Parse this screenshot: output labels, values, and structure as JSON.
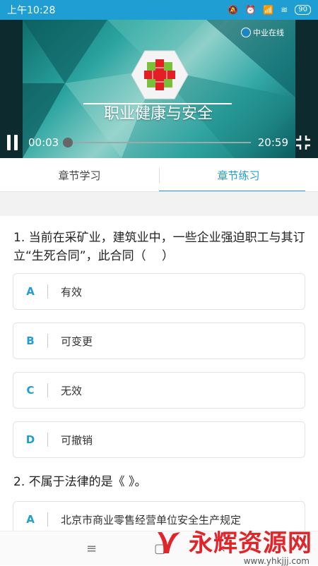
{
  "status_bar": {
    "time": "上午10:28",
    "battery": "90",
    "network": "4G"
  },
  "video": {
    "title": "职业健康与安全",
    "brand": "中业在线",
    "current_time": "00:03",
    "duration": "20:59",
    "progress": 0.002
  },
  "tabs": [
    {
      "label": "章节学习",
      "active": false
    },
    {
      "label": "章节练习",
      "active": true
    }
  ],
  "questions": [
    {
      "text": "1. 当前在采矿业，建筑业中，一些企业强迫职工与其订立“生死合同”，此合同（　 ）",
      "options": [
        {
          "letter": "A",
          "text": "有效"
        },
        {
          "letter": "B",
          "text": "可变更"
        },
        {
          "letter": "C",
          "text": "无效"
        },
        {
          "letter": "D",
          "text": "可撤销"
        }
      ]
    },
    {
      "text": "2. 不属于法律的是《 》。",
      "options": [
        {
          "letter": "A",
          "text": "北京市商业零售经营单位安全生产规定"
        }
      ]
    }
  ],
  "nav": {
    "menu_icon": "menu-icon",
    "home_icon": "home-icon",
    "back_icon": "back-icon"
  },
  "watermark": {
    "text": "永辉资源网",
    "url": "www.yhkjjj.com"
  },
  "colors": {
    "accent": "#1e9ed3",
    "watermark_red": "#e0252b"
  }
}
